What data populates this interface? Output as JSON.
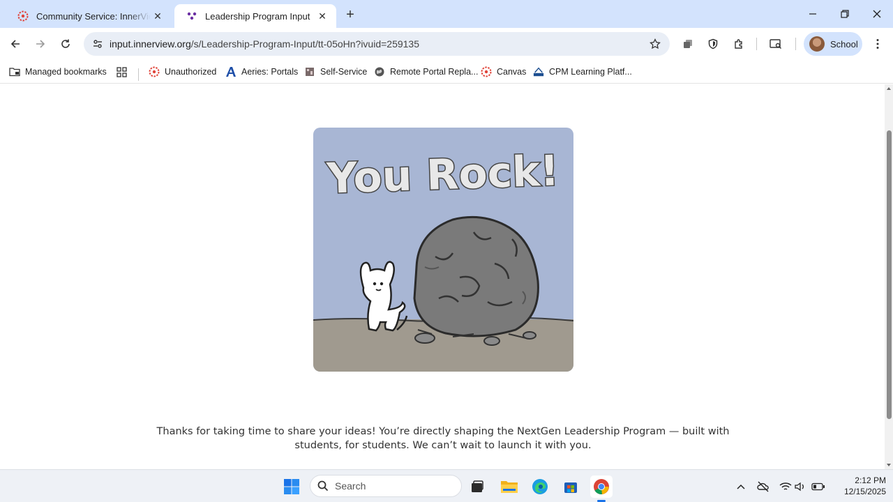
{
  "tabs": [
    {
      "title": "Community Service: InnerView | Leadership",
      "active": false
    },
    {
      "title": "Leadership Program Input",
      "active": true
    }
  ],
  "toolbar": {
    "url_domain": "input.innerview.org",
    "url_path": "/s/Leadership-Program-Input/tt-05oHn?ivuid=259135",
    "profile_label": "School"
  },
  "bookmarks": [
    {
      "label": "Managed bookmarks",
      "icon": "folder-icon"
    },
    {
      "label": "Unauthorized",
      "icon": "canvas-icon"
    },
    {
      "label": "Aeries: Portals",
      "icon": "aeries-icon"
    },
    {
      "label": "Self-Service",
      "icon": "self-service-icon"
    },
    {
      "label": "Remote Portal Repla...",
      "icon": "globe-icon"
    },
    {
      "label": "Canvas",
      "icon": "canvas-icon"
    },
    {
      "label": "CPM Learning Platf...",
      "icon": "cpm-icon"
    }
  ],
  "content": {
    "image_text": "You Rock!",
    "message_line1": "Thanks for taking  time to share your ideas! You’re directly shaping the NextGen Leadership Program — built with",
    "message_line2": "students, for students. We can’t wait to launch it with you."
  },
  "taskbar": {
    "search_placeholder": "Search",
    "time": "2:12 PM",
    "date": "12/15/2025"
  },
  "colors": {
    "tabstrip": "#d3e3fd",
    "accent_red": "#e0443a",
    "accent_purple": "#6b2fa3",
    "image_sky": "#a8b6d4",
    "image_ground": "#a09a8f"
  }
}
